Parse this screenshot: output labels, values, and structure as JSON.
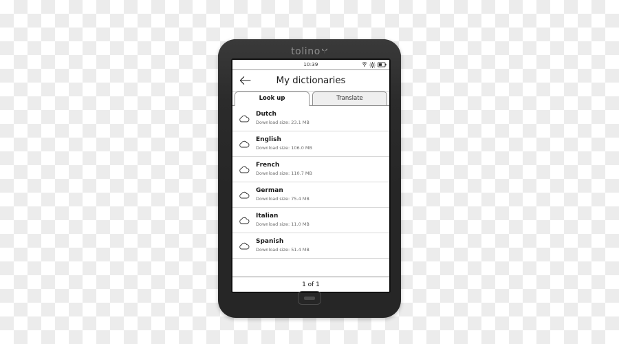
{
  "device": {
    "brand": "tolino",
    "brand_mark_icon": "butterfly-icon",
    "home_button_icon": "home-button-icon"
  },
  "statusbar": {
    "time": "10:39",
    "icons": [
      "wifi-icon",
      "brightness-icon",
      "battery-icon"
    ]
  },
  "header": {
    "back_icon": "back-arrow-icon",
    "title": "My dictionaries"
  },
  "tabs": [
    {
      "label": "Look up",
      "active": true
    },
    {
      "label": "Translate",
      "active": false
    }
  ],
  "list": {
    "size_label": "Download size:",
    "items": [
      {
        "language": "Dutch",
        "size_text": "Download size:  23.1 MB",
        "icon": "cloud-download-icon"
      },
      {
        "language": "English",
        "size_text": "Download size:  106.0 MB",
        "icon": "cloud-download-icon"
      },
      {
        "language": "French",
        "size_text": "Download size:  110.7 MB",
        "icon": "cloud-download-icon"
      },
      {
        "language": "German",
        "size_text": "Download size:  75.4 MB",
        "icon": "cloud-download-icon"
      },
      {
        "language": "Italian",
        "size_text": "Download size:  11.0 MB",
        "icon": "cloud-download-icon"
      },
      {
        "language": "Spanish",
        "size_text": "Download size:  51.4 MB",
        "icon": "cloud-download-icon"
      }
    ]
  },
  "footer": {
    "pagination": "1 of 1"
  },
  "colors": {
    "device_body": "#262626",
    "screen_bg": "#ffffff",
    "text_primary": "#1b1b1b",
    "text_secondary": "#6a6a6a",
    "tab_inactive_bg": "#efefef",
    "border": "#8f8f8f"
  }
}
